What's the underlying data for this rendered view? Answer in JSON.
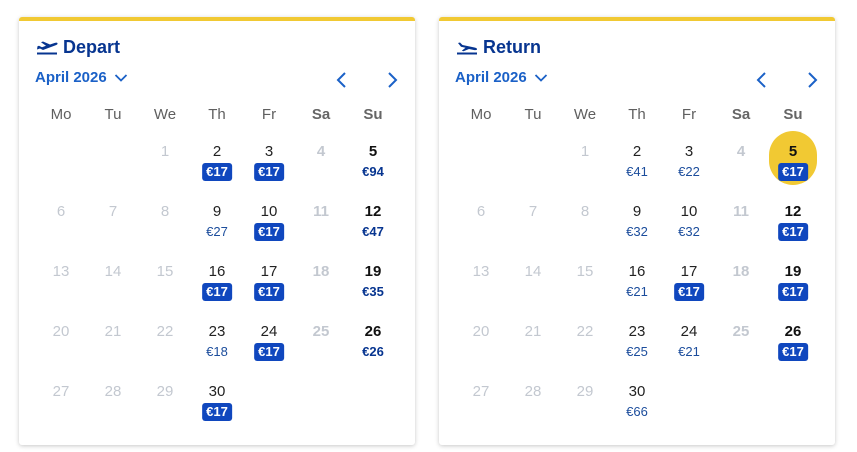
{
  "colors": {
    "accent_bar": "#f1c933",
    "title": "#073590",
    "month": "#1b61c7",
    "badge_bg": "#1047be",
    "selected_bg": "#f1c933",
    "disabled_text": "#c3c8d0"
  },
  "weekdays": [
    "Mo",
    "Tu",
    "We",
    "Th",
    "Fr",
    "Sa",
    "Su"
  ],
  "panels": [
    {
      "id": "depart",
      "title": "Depart",
      "icon": "plane-takeoff-icon",
      "month": "April 2026",
      "weeks": [
        [
          null,
          null,
          {
            "day": "1",
            "disabled": true
          },
          {
            "day": "2",
            "price": "€17",
            "badge": true
          },
          {
            "day": "3",
            "price": "€17",
            "badge": true
          },
          {
            "day": "4",
            "disabled": true
          },
          {
            "day": "5",
            "price": "€94"
          }
        ],
        [
          {
            "day": "6",
            "disabled": true
          },
          {
            "day": "7",
            "disabled": true
          },
          {
            "day": "8",
            "disabled": true
          },
          {
            "day": "9",
            "price": "€27"
          },
          {
            "day": "10",
            "price": "€17",
            "badge": true
          },
          {
            "day": "11",
            "disabled": true
          },
          {
            "day": "12",
            "price": "€47"
          }
        ],
        [
          {
            "day": "13",
            "disabled": true
          },
          {
            "day": "14",
            "disabled": true
          },
          {
            "day": "15",
            "disabled": true
          },
          {
            "day": "16",
            "price": "€17",
            "badge": true
          },
          {
            "day": "17",
            "price": "€17",
            "badge": true
          },
          {
            "day": "18",
            "disabled": true
          },
          {
            "day": "19",
            "price": "€35"
          }
        ],
        [
          {
            "day": "20",
            "disabled": true
          },
          {
            "day": "21",
            "disabled": true
          },
          {
            "day": "22",
            "disabled": true
          },
          {
            "day": "23",
            "price": "€18"
          },
          {
            "day": "24",
            "price": "€17",
            "badge": true
          },
          {
            "day": "25",
            "disabled": true
          },
          {
            "day": "26",
            "price": "€26"
          }
        ],
        [
          {
            "day": "27",
            "disabled": true
          },
          {
            "day": "28",
            "disabled": true
          },
          {
            "day": "29",
            "disabled": true
          },
          {
            "day": "30",
            "price": "€17",
            "badge": true
          },
          null,
          null,
          null
        ]
      ]
    },
    {
      "id": "return",
      "title": "Return",
      "icon": "plane-landing-icon",
      "month": "April 2026",
      "weeks": [
        [
          null,
          null,
          {
            "day": "1",
            "disabled": true
          },
          {
            "day": "2",
            "price": "€41"
          },
          {
            "day": "3",
            "price": "€22"
          },
          {
            "day": "4",
            "disabled": true
          },
          {
            "day": "5",
            "price": "€17",
            "badge": true,
            "selected": true
          }
        ],
        [
          {
            "day": "6",
            "disabled": true
          },
          {
            "day": "7",
            "disabled": true
          },
          {
            "day": "8",
            "disabled": true
          },
          {
            "day": "9",
            "price": "€32"
          },
          {
            "day": "10",
            "price": "€32"
          },
          {
            "day": "11",
            "disabled": true
          },
          {
            "day": "12",
            "price": "€17",
            "badge": true
          }
        ],
        [
          {
            "day": "13",
            "disabled": true
          },
          {
            "day": "14",
            "disabled": true
          },
          {
            "day": "15",
            "disabled": true
          },
          {
            "day": "16",
            "price": "€21"
          },
          {
            "day": "17",
            "price": "€17",
            "badge": true
          },
          {
            "day": "18",
            "disabled": true
          },
          {
            "day": "19",
            "price": "€17",
            "badge": true
          }
        ],
        [
          {
            "day": "20",
            "disabled": true
          },
          {
            "day": "21",
            "disabled": true
          },
          {
            "day": "22",
            "disabled": true
          },
          {
            "day": "23",
            "price": "€25"
          },
          {
            "day": "24",
            "price": "€21"
          },
          {
            "day": "25",
            "disabled": true
          },
          {
            "day": "26",
            "price": "€17",
            "badge": true
          }
        ],
        [
          {
            "day": "27",
            "disabled": true
          },
          {
            "day": "28",
            "disabled": true
          },
          {
            "day": "29",
            "disabled": true
          },
          {
            "day": "30",
            "price": "€66"
          },
          null,
          null,
          null
        ]
      ]
    }
  ]
}
